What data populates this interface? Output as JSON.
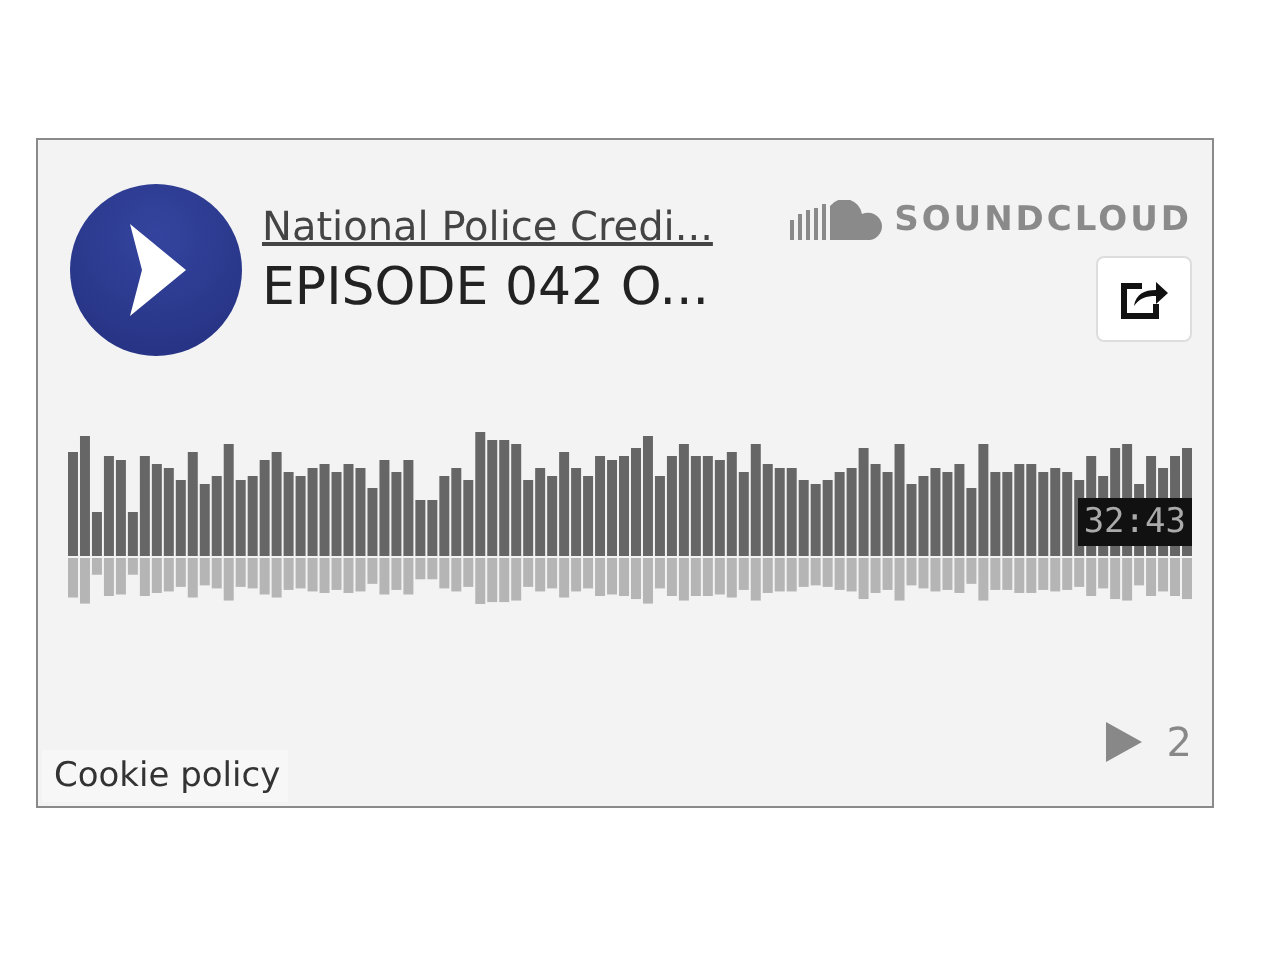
{
  "player": {
    "artist": "National Police Credi...",
    "title": "EPISODE 042 O...",
    "brand": "SOUNDCLOUD",
    "duration": "32:43",
    "play_count": "2"
  },
  "cookie_link": "Cookie policy"
}
